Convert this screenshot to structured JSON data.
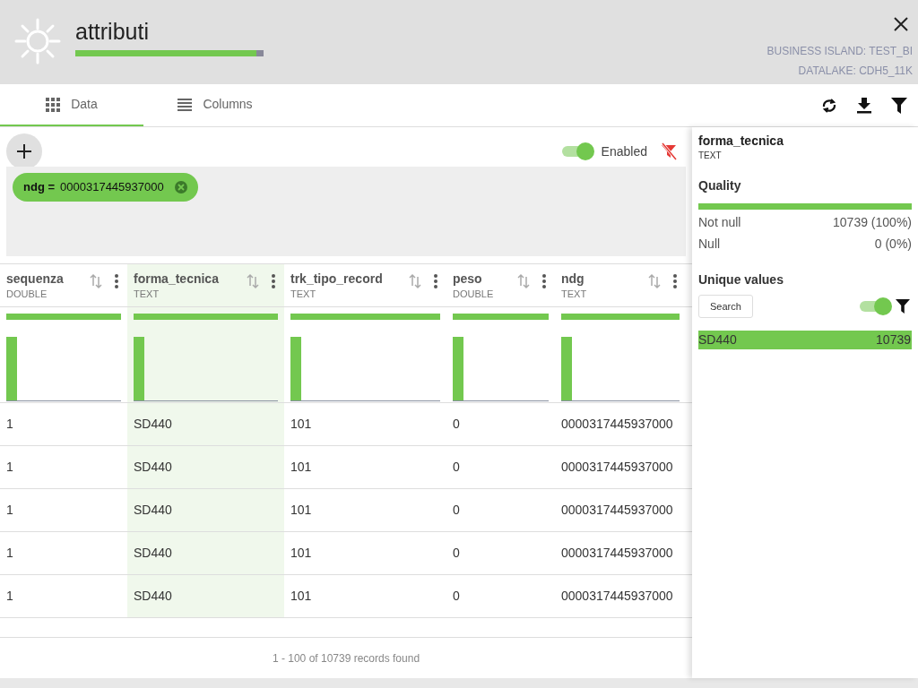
{
  "header": {
    "title": "attributi",
    "level": 0.96,
    "business_island": "BUSINESS ISLAND: TEST_BI",
    "datalake": "DATALAKE: CDH5_11K"
  },
  "tabs": [
    {
      "label": "Data",
      "kind": "grid",
      "selected": true
    },
    {
      "label": "Columns",
      "kind": "list",
      "selected": false
    }
  ],
  "filters": {
    "enabled_label": "Enabled",
    "enabled": true,
    "chips": [
      {
        "field": "ndg =",
        "value": "0000317445937000"
      }
    ]
  },
  "table": {
    "columns": [
      {
        "name": "sequenza",
        "type": "DOUBLE",
        "selected": false
      },
      {
        "name": "forma_tecnica",
        "type": "TEXT",
        "selected": true
      },
      {
        "name": "trk_tipo_record",
        "type": "TEXT",
        "selected": false
      },
      {
        "name": "peso",
        "type": "DOUBLE",
        "selected": false
      },
      {
        "name": "ndg",
        "type": "TEXT",
        "selected": false
      }
    ],
    "rows": [
      [
        "1",
        "SD440",
        "101",
        "0",
        "0000317445937000"
      ],
      [
        "1",
        "SD440",
        "101",
        "0",
        "0000317445937000"
      ],
      [
        "1",
        "SD440",
        "101",
        "0",
        "0000317445937000"
      ],
      [
        "1",
        "SD440",
        "101",
        "0",
        "0000317445937000"
      ],
      [
        "1",
        "SD440",
        "101",
        "0",
        "0000317445937000"
      ]
    ],
    "footer": "1 - 100 of 10739 records found"
  },
  "side_panel": {
    "column": "forma_tecnica",
    "type": "TEXT",
    "quality_title": "Quality",
    "level": 1,
    "stats": [
      {
        "label": "Not null",
        "value": "10739 (100%)"
      },
      {
        "label": "Null",
        "value": "0 (0%)"
      }
    ],
    "unique_title": "Unique values",
    "search_label": "Search",
    "unique_filter_on": true,
    "values": [
      {
        "value": "SD440",
        "count": "10739"
      }
    ]
  }
}
